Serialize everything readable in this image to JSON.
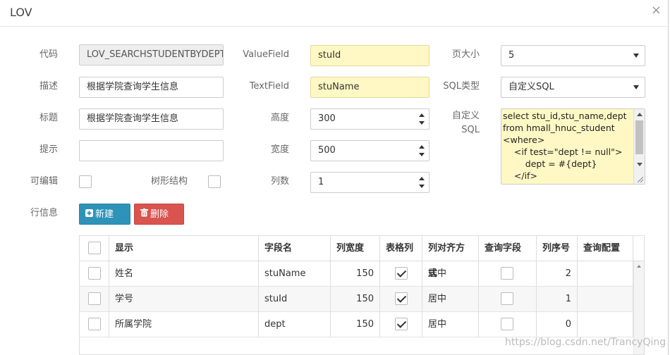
{
  "dialog": {
    "title": "LOV",
    "close_glyph": "×"
  },
  "form": {
    "code_label": "代码",
    "code_value": "LOV_SEARCHSTUDENTBYDEPT",
    "desc_label": "描述",
    "desc_value": "根据学院查询学生信息",
    "title_label": "标题",
    "title_value": "根据学院查询学生信息",
    "hint_label": "提示",
    "hint_value": "",
    "editable_label": "可编辑",
    "tree_label": "树形结构",
    "valuefield_label": "ValueField",
    "valuefield_value": "stuId",
    "textfield_label": "TextField",
    "textfield_value": "stuName",
    "height_label": "高度",
    "height_value": "300",
    "width_label": "宽度",
    "width_value": "500",
    "columns_label": "列数",
    "columns_value": "1",
    "pagesize_label": "页大小",
    "pagesize_value": "5",
    "sqltype_label": "SQL类型",
    "sqltype_value": "自定义SQL",
    "customsql_label_1": "自定义",
    "customsql_label_2": "SQL",
    "sql_lines": [
      "select stu_id,stu_name,dept",
      "from hmall_hnuc_student",
      "<where>",
      "    <if test=\"dept != null\">",
      "        dept = #{dept}",
      "    </if>"
    ],
    "rowinfo_label": "行信息"
  },
  "buttons": {
    "new_label": "新建",
    "delete_label": "删除"
  },
  "grid": {
    "headers": [
      "显示",
      "字段名",
      "列宽度",
      "表格列",
      "列对齐方式",
      "查询字段",
      "列序号",
      "查询配置"
    ],
    "rows": [
      {
        "display": "姓名",
        "field": "stuName",
        "width": "150",
        "grid_col": true,
        "align": "居中",
        "query": false,
        "order": "2"
      },
      {
        "display": "学号",
        "field": "stuId",
        "width": "150",
        "grid_col": true,
        "align": "居中",
        "query": false,
        "order": "1"
      },
      {
        "display": "所属学院",
        "field": "dept",
        "width": "150",
        "grid_col": true,
        "align": "居中",
        "query": false,
        "order": "0"
      }
    ]
  },
  "watermark": "https://blog.csdn.net/TrancyQing"
}
